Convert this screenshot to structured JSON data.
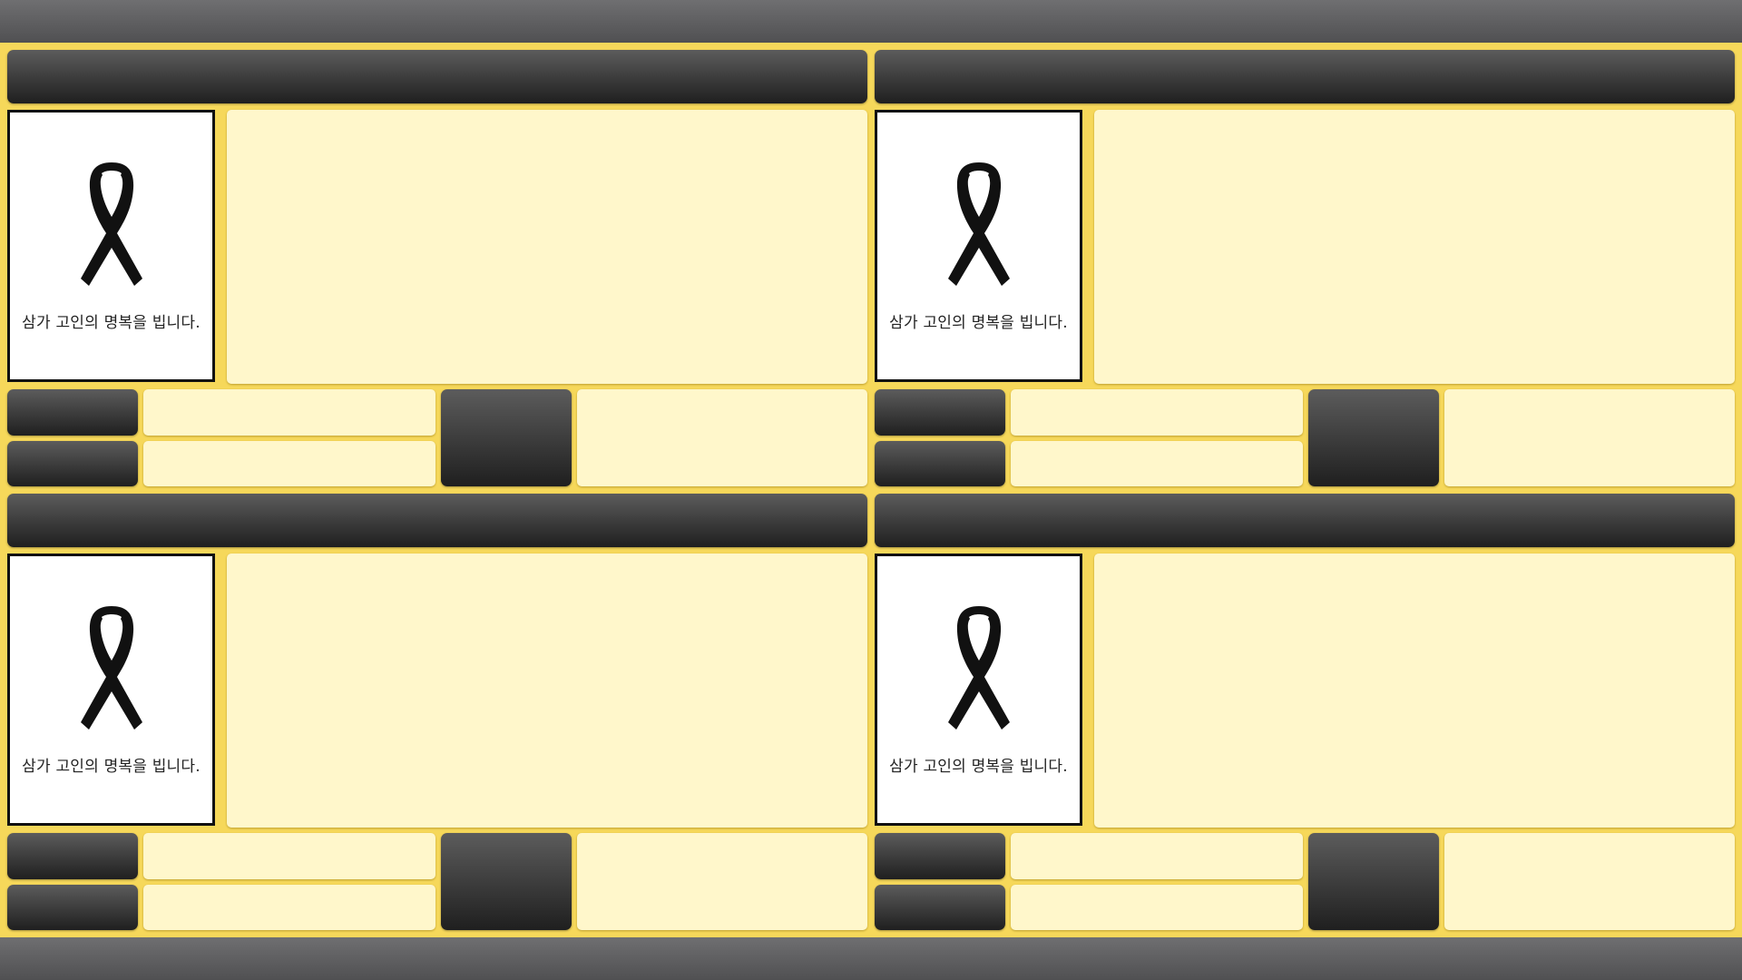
{
  "colors": {
    "background": "#f6d85a",
    "panel_cream": "#fff7cb",
    "dark_block": "#2e2e2e",
    "bar_gray": "#5f5f61"
  },
  "panels": [
    {
      "condolence_text": "삼가 고인의 명복을 빕니다.",
      "icon": "black-ribbon-icon"
    },
    {
      "condolence_text": "삼가 고인의 명복을 빕니다.",
      "icon": "black-ribbon-icon"
    },
    {
      "condolence_text": "삼가 고인의 명복을 빕니다.",
      "icon": "black-ribbon-icon"
    },
    {
      "condolence_text": "삼가 고인의 명복을 빕니다.",
      "icon": "black-ribbon-icon"
    }
  ]
}
